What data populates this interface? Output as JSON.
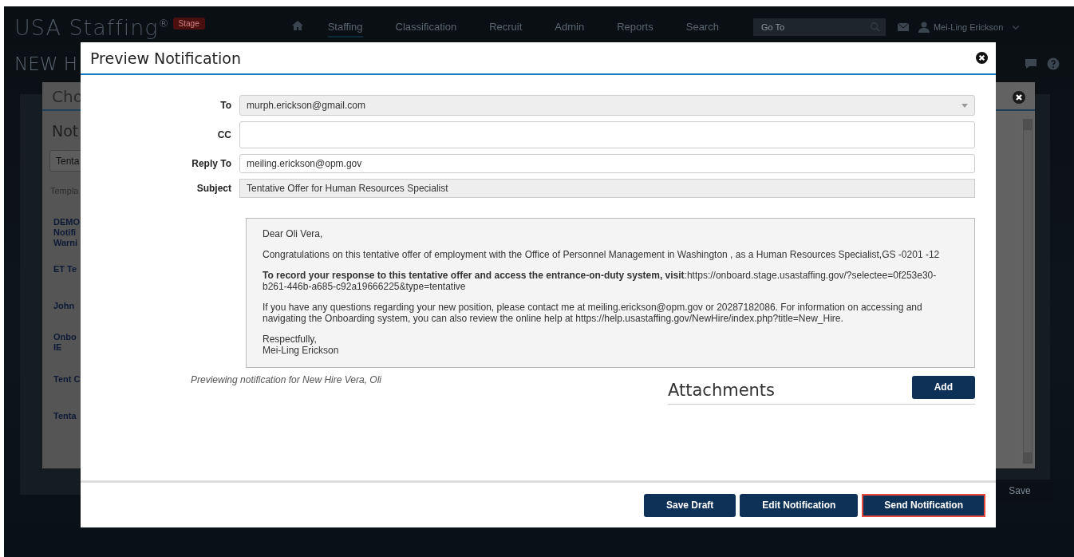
{
  "background": {
    "logo": "USA Staffing",
    "logo_mark": "®",
    "env_badge": "Stage",
    "nav": [
      {
        "label": "Staffing",
        "selected": true
      },
      {
        "label": "Classification",
        "selected": false
      },
      {
        "label": "Recruit",
        "selected": false
      },
      {
        "label": "Admin",
        "selected": false
      },
      {
        "label": "Reports",
        "selected": false
      },
      {
        "label": "Search",
        "selected": false
      }
    ],
    "goto": {
      "placeholder": "Go To"
    },
    "user": "Mei-Ling Erickson",
    "page_title": "NEW H",
    "save": "Save",
    "dialog": {
      "title": "Cho",
      "heading": "Not",
      "search": {
        "value": "Tenta"
      },
      "column": "Templa",
      "items": [
        [
          "DEMO",
          "Notifi",
          "Warni"
        ],
        [
          "ET Te"
        ],
        [
          "John"
        ],
        [
          "Onbo",
          "IE"
        ],
        [
          "Tent C"
        ],
        [
          "Tenta"
        ]
      ]
    }
  },
  "modal": {
    "title": "Preview Notification",
    "fields": [
      {
        "label": "To",
        "value": "murph.erickson@gmail.com",
        "kind": "select"
      },
      {
        "label": "CC",
        "kind": "textarea"
      },
      {
        "label": "Reply To",
        "value": "meiling.erickson@opm.gov",
        "kind": "input"
      },
      {
        "label": "Subject",
        "value": "Tentative Offer for Human Resources Specialist",
        "kind": "readonly"
      }
    ],
    "message": [
      [
        "Dear Oli Vera,"
      ],
      [
        "Congratulations on this tentative offer of employment with the Office of Personnel Management in Washington , as a Human Resources Specialist,GS -0201 -12"
      ],
      [
        "**To record your response to this tentative offer and access the entrance-on-duty system, visit**:https://onboard.stage.usastaffing.gov/?selectee=0f253e30-b261-446b-a685-c92a19666225&type=tentative"
      ],
      [
        "If you have any questions regarding your new position, please contact me at meiling.erickson@opm.gov or 20287182086. For information on accessing and navigating the Onboarding system, you can also review the online help at https://help.usastaffing.gov/NewHire/index.php?title=New_Hire."
      ],
      [
        "Respectfully,",
        "Mei-Ling Erickson"
      ]
    ],
    "caption": "Previewing notification for New Hire Vera, Oli",
    "attachments": {
      "title": "Attachments",
      "add": "Add"
    },
    "buttons": [
      {
        "label": "Save Draft",
        "selected": false
      },
      {
        "label": "Edit Notification",
        "selected": false
      },
      {
        "label": "Send Notification",
        "selected": true
      }
    ]
  }
}
